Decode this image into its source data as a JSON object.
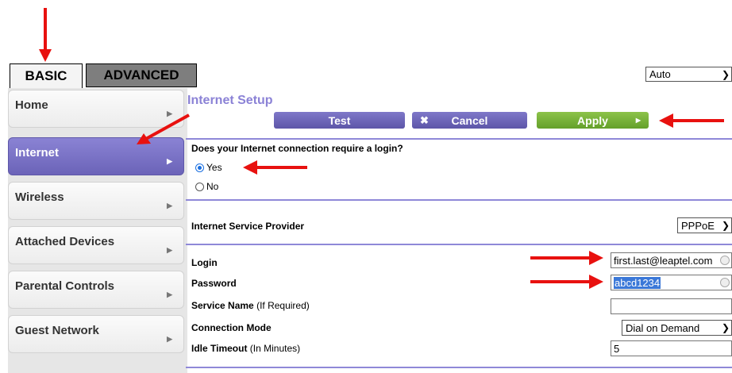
{
  "tabs": {
    "basic": "BASIC",
    "advanced": "ADVANCED"
  },
  "language_select": {
    "value": "Auto"
  },
  "sidebar": {
    "items": [
      {
        "label": "Home"
      },
      {
        "label": "Internet"
      },
      {
        "label": "Wireless"
      },
      {
        "label": "Attached Devices"
      },
      {
        "label": "Parental Controls"
      },
      {
        "label": "Guest Network"
      }
    ]
  },
  "page": {
    "title": "Internet Setup"
  },
  "buttons": {
    "test": "Test",
    "cancel": "Cancel",
    "apply": "Apply"
  },
  "login_question": {
    "text": "Does your Internet connection require a login?",
    "yes": "Yes",
    "no": "No",
    "selected": "Yes"
  },
  "isp": {
    "label": "Internet Service Provider",
    "value": "PPPoE"
  },
  "form": {
    "login_label": "Login",
    "login_value": "first.last@leaptel.com",
    "password_label": "Password",
    "password_value": "abcd1234",
    "service_name_label": "Service Name",
    "service_name_hint": "(If Required)",
    "service_name_value": "",
    "connection_mode_label": "Connection Mode",
    "connection_mode_value": "Dial on Demand",
    "idle_timeout_label": "Idle Timeout",
    "idle_timeout_hint": "(In Minutes)",
    "idle_timeout_value": "5"
  },
  "colors": {
    "accent": "#8b82d6",
    "apply": "#7ab23c",
    "annotation": "#e8110f"
  }
}
